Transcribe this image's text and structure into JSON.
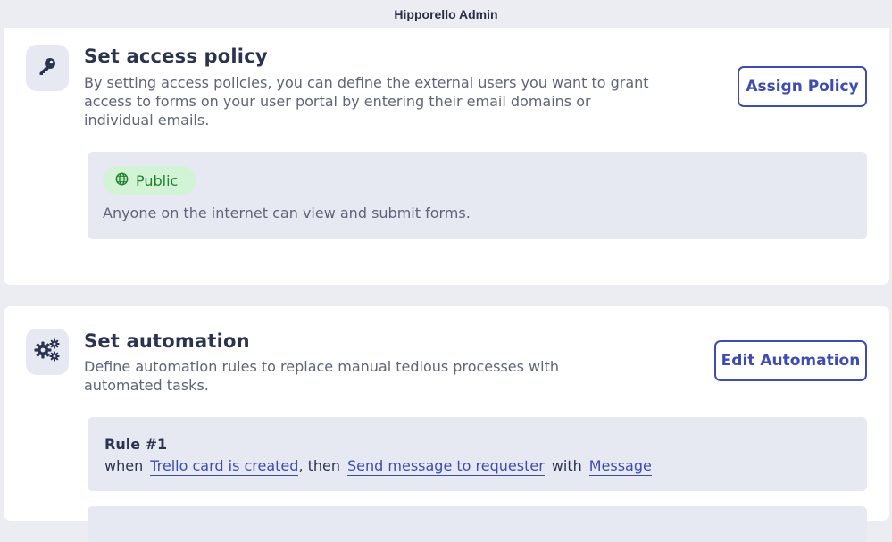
{
  "window": {
    "title": "Hipporello Admin"
  },
  "access_policy": {
    "icon": "key-icon",
    "heading": "Set access policy",
    "description": "By setting access policies, you can define the external users you want to grant access to forms on your user portal by entering their email domains or individual emails.",
    "button_label": "Assign Policy",
    "policy": {
      "badge_icon": "globe-icon",
      "badge_label": "Public",
      "badge_color": "#21822f",
      "badge_bg": "#d3f3d6",
      "text": "Anyone on the internet can view and submit forms."
    }
  },
  "automation": {
    "icon": "gears-icon",
    "heading": "Set automation",
    "description": "Define automation rules to replace manual tedious processes with automated tasks.",
    "button_label": "Edit Automation",
    "rules": [
      {
        "title": "Rule #1",
        "when_word": "when",
        "trigger": "Trello card is created",
        "then_word": ", then",
        "action": "Send message to requester",
        "with_word": "with",
        "payload": "Message"
      }
    ]
  },
  "colors": {
    "accent": "#3c4cb0",
    "text": "#2b3350",
    "muted": "#5f6478",
    "panel_bg": "#e6e8f2",
    "page_bg": "#ebedf2"
  }
}
